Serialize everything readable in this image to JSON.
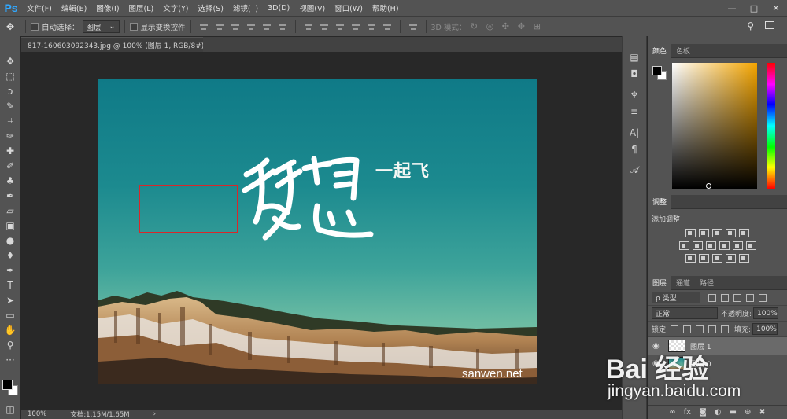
{
  "app": {
    "logo": "Ps"
  },
  "menubar": {
    "items": [
      "文件(F)",
      "编辑(E)",
      "图像(I)",
      "图层(L)",
      "文字(Y)",
      "选择(S)",
      "滤镜(T)",
      "3D(D)",
      "视图(V)",
      "窗口(W)",
      "帮助(H)"
    ]
  },
  "window_controls": {
    "minimize": "—",
    "maximize": "□",
    "close": "✕"
  },
  "options_bar": {
    "auto_select_label": "自动选择：",
    "auto_select_value": "图层",
    "show_transform_label": "显示变换控件",
    "mode_3d_label": "3D 模式："
  },
  "document": {
    "tab_title": "817-160603092343.jpg @ 100% (图层 1, RGB/8#) *",
    "tab_close": "×",
    "text_dream": "梦想",
    "text_fly": "一起飞",
    "text_site": "sanwen.net"
  },
  "status_bar": {
    "zoom": "100%",
    "doc_info": "文档:1.15M/1.65M",
    "arrow": "›"
  },
  "panels": {
    "color_tabs": [
      "颜色",
      "色板"
    ],
    "adjust_tab": "调整",
    "add_adjustment": "添加调整",
    "layer_tabs": [
      "图层",
      "通道",
      "路径"
    ],
    "filter_kind": "ρ 类型",
    "blend_mode": "正常",
    "opacity_label": "不透明度:",
    "opacity_value": "100%",
    "lock_label": "锁定:",
    "fill_label": "填充:",
    "fill_value": "100%",
    "layers": [
      "图层 1",
      "图层 0"
    ]
  },
  "watermark": {
    "brand": "Bai 经验",
    "url": "jingyan.baidu.com"
  }
}
